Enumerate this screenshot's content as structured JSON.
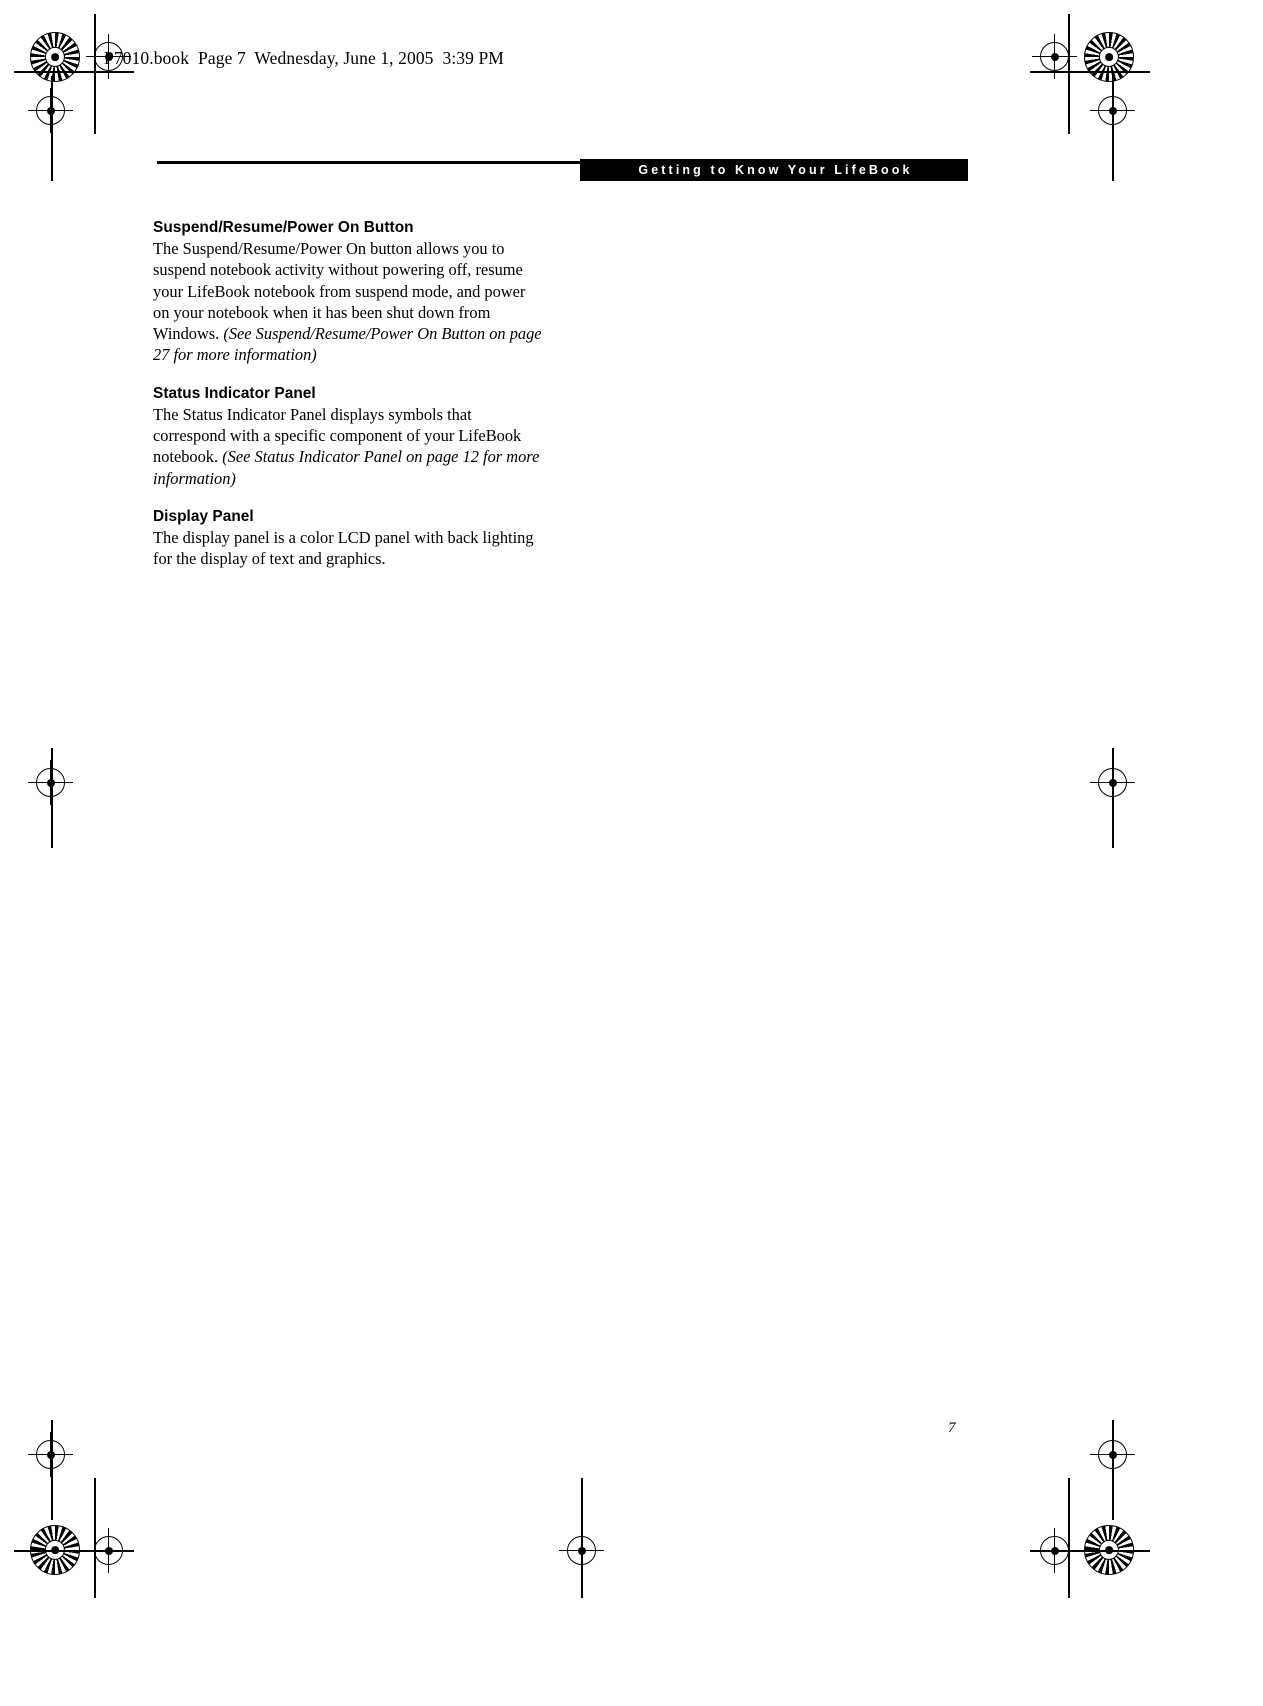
{
  "document": {
    "file_header": "P7010.book  Page 7  Wednesday, June 1, 2005  3:39 PM",
    "chapter_banner": "Getting to Know Your LifeBook",
    "page_number": "7",
    "accent_color": "#000000",
    "background_color": "#ffffff"
  },
  "sections": [
    {
      "heading": "Suspend/Resume/Power On Button",
      "body_plain": "The Suspend/Resume/Power On button allows you to suspend notebook activity without powering off, resume your LifeBook notebook from suspend mode, and power on your notebook when it has been shut down from Windows. ",
      "body_italic": "(See Suspend/Resume/Power On Button on page 27 for more information)"
    },
    {
      "heading": "Status Indicator Panel",
      "body_plain": "The Status Indicator Panel displays symbols that correspond with a specific component of your LifeBook notebook. ",
      "body_italic": "(See Status Indicator Panel on page 12 for more information)"
    },
    {
      "heading": "Display Panel",
      "body_plain": "The display panel is a color LCD panel with back lighting for the display of text and graphics.",
      "body_italic": ""
    }
  ]
}
